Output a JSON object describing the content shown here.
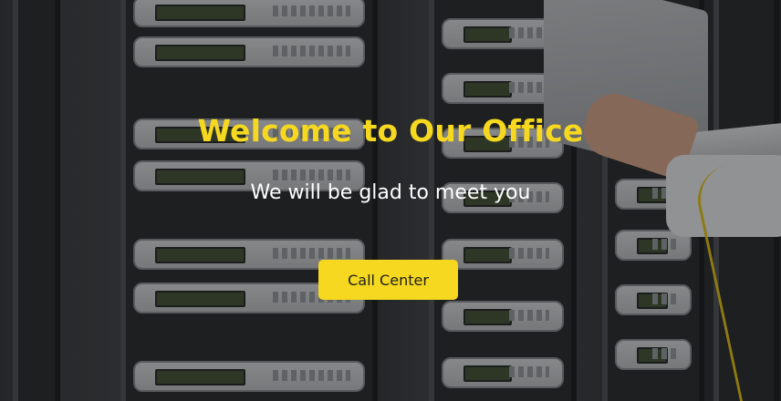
{
  "hero": {
    "title": "Welcome to Our Office",
    "subtitle": "We will be glad to meet you",
    "cta_label": "Call Center",
    "background_image": "server-room-photo",
    "colors": {
      "accent": "#f5d81f",
      "subtitle": "#ffffff",
      "button_text": "#1e1e1e"
    }
  }
}
